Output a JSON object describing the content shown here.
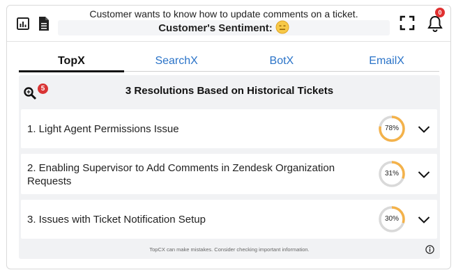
{
  "header": {
    "summary": "Customer wants to know how to update comments on a ticket.",
    "sentiment_label": "Customer's Sentiment:",
    "sentiment_icon": "neutral-face-icon",
    "notifications_count": "0"
  },
  "tabs": [
    {
      "label": "TopX",
      "active": true
    },
    {
      "label": "SearchX",
      "active": false
    },
    {
      "label": "BotX",
      "active": false
    },
    {
      "label": "EmailX",
      "active": false
    }
  ],
  "panel": {
    "title": "3 Resolutions Based on Historical Tickets",
    "search_badge": "5",
    "resolutions": [
      {
        "label": "1. Light Agent Permissions Issue",
        "percent": 78,
        "percent_label": "78%"
      },
      {
        "label": "2. Enabling Supervisor to Add Comments in Zendesk Organization Requests",
        "percent": 31,
        "percent_label": "31%"
      },
      {
        "label": "3. Issues with Ticket Notification Setup",
        "percent": 30,
        "percent_label": "30%"
      }
    ],
    "disclaimer": "TopCX can make mistakes. Consider checking important information."
  },
  "colors": {
    "accent": "#2a73c8",
    "ring_fill": "#f4b24a",
    "ring_track": "#d9d9d9",
    "badge": "#e03030",
    "emoji": "#f7c948"
  }
}
